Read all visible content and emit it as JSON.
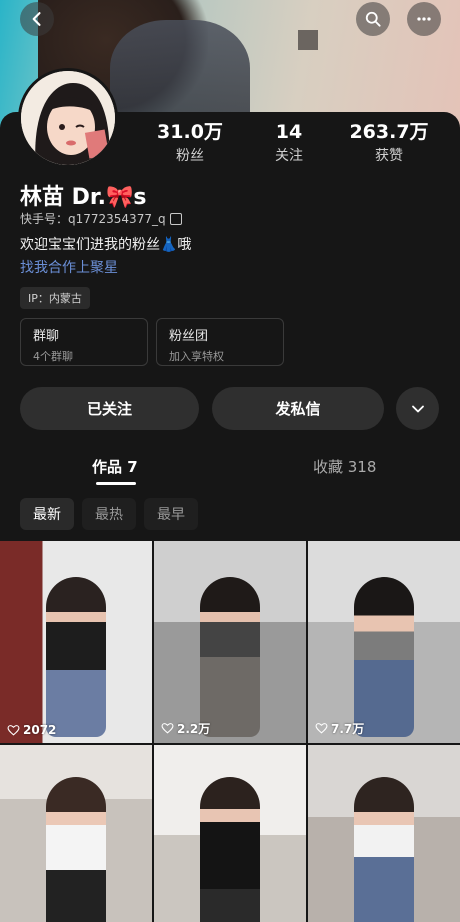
{
  "profile": {
    "name": "林苗 Dr.🎀s",
    "kuaishou_id": "快手号：q1772354377_q",
    "bio": "欢迎宝宝们进我的粉丝👗哦",
    "cooperate_link": "找我合作上聚星",
    "ip": "IP：内蒙古"
  },
  "stats": [
    {
      "value": "31.0万",
      "label": "粉丝"
    },
    {
      "value": "14",
      "label": "关注"
    },
    {
      "value": "263.7万",
      "label": "获赞"
    }
  ],
  "groups": [
    {
      "title": "群聊",
      "subtitle": "4个群聊"
    },
    {
      "title": "粉丝团",
      "subtitle": "加入享特权"
    }
  ],
  "actions": {
    "followed": "已关注",
    "message": "发私信"
  },
  "tabs": {
    "works": "作品 7",
    "favorites": "收藏 318"
  },
  "filters": [
    "最新",
    "最热",
    "最早"
  ],
  "videos": [
    {
      "likes": "2072"
    },
    {
      "likes": "2.2万"
    },
    {
      "likes": "7.7万"
    },
    {
      "likes": ""
    },
    {
      "likes": ""
    },
    {
      "likes": ""
    }
  ],
  "icons": {
    "back": "back-arrow-icon",
    "search": "search-icon",
    "more": "more-icon",
    "copy": "copy-icon",
    "expand": "chevron-down-icon",
    "like": "heart-icon"
  }
}
